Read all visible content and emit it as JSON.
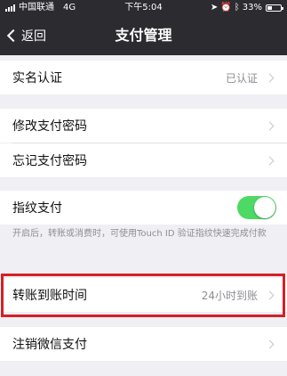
{
  "status_bar": {
    "carrier": "中国联通",
    "network": "4G",
    "time": "下午5:04",
    "battery": "33%",
    "battery_level": 0.33
  },
  "nav": {
    "back_label": "返回",
    "title": "支付管理"
  },
  "sections": {
    "real_name": {
      "label": "实名认证",
      "value": "已认证"
    },
    "change_password": {
      "label": "修改支付密码"
    },
    "forgot_password": {
      "label": "忘记支付密码"
    },
    "fingerprint": {
      "label": "指纹支付",
      "enabled": true,
      "note": "开启后，转账或消费时，可使用Touch ID 验证指纹快速完成付款"
    },
    "transfer_time": {
      "label": "转账到账时间",
      "value": "24小时到账"
    },
    "cancel_wechat_pay": {
      "label": "注销微信支付"
    }
  },
  "colors": {
    "nav_bg": "#2b2b30",
    "toggle_on": "#4cd964",
    "highlight": "#d42127",
    "page_bg": "#efeff4"
  }
}
